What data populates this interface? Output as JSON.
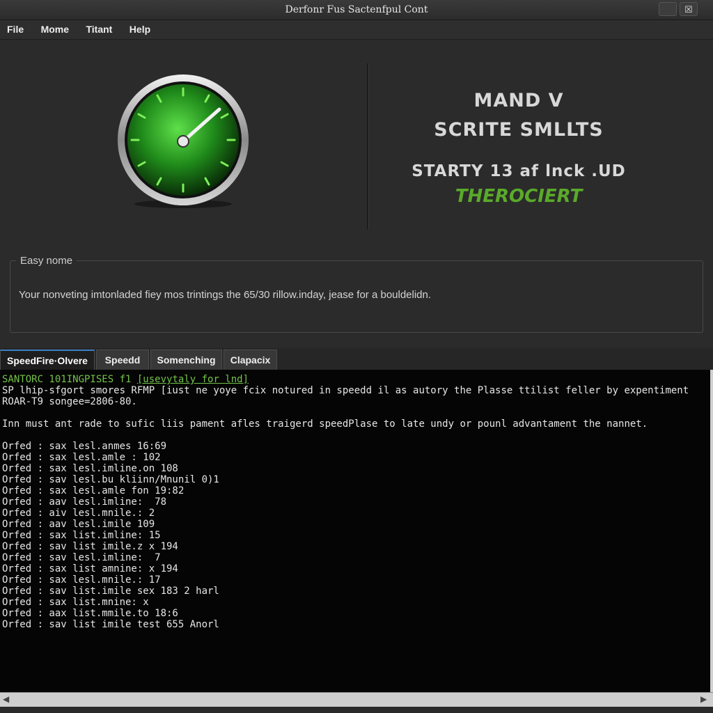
{
  "window": {
    "title": "Derfonr Fus Sactenfpul Cont",
    "minimize_glyph": "",
    "close_glyph": "☒"
  },
  "menu": [
    "File",
    "Mome",
    "Titant",
    "Help"
  ],
  "hero": {
    "line1": "MAND V",
    "line2": "SCRITE SMLLTS",
    "line3": "STARTY 13 af lnck .UD",
    "line4": "THEROCIERT",
    "accent_color": "#5aaa2a",
    "gauge_icon": "speedometer-icon"
  },
  "easy": {
    "legend": "Easy nome",
    "text": "Your nonveting imtonladed fiey mos trintings the 65/30 rillow.inday, jease for a bouldelidn."
  },
  "tabs": [
    "SpeedFire·Olvere",
    "Speedd",
    "Somenching",
    "Clapacix"
  ],
  "console": {
    "header": [
      {
        "text": "SANTORC 101INGPISES f1 ",
        "green": true,
        "extra": "[usevytaly for lnd]"
      },
      {
        "text": "SP lhip-sfgort smores RFMP [iust ne yoye fcix notured in speedd il as autory the Plasse ttilist feller by expentiment"
      },
      {
        "text": "ROAR-T9 songee=2806-80."
      },
      {
        "text": ""
      },
      {
        "text": "Inn must ant rade to sufic liis pament afles traigerd speedPlase to late undy or pounl advantament the nannet."
      }
    ],
    "log": [
      "Orfed : sax lesl.anmes 16:69",
      "Orfed : sax lesl.amle : 102",
      "Orfed : sax lesl.imline.on 108",
      "Orfed : sav lesl.bu kliinn/Mnunil 0)1",
      "Orfed : sax lesl.amle fon 19:82",
      "Orfed : aav lesl.imline:  78",
      "Orfed : aiv lesl.mnile.: 2",
      "Orfed : aav lesl.imile 109",
      "Orfed : sax list.imline: 15",
      "Orfed : sav list imile.z x 194",
      "Orfed : sav lesl.imline:  7",
      "Orfed : sax list amnine: x 194",
      "Orfed : sax lesl.mnile.: 17",
      "Orfed : sav list.imile sex 183 2 harl",
      "Orfed : sax list.mnine: x",
      "Orfed : aax list.mmile.to 18:6",
      "Orfed : sav list imile test 655 Anorl"
    ]
  }
}
